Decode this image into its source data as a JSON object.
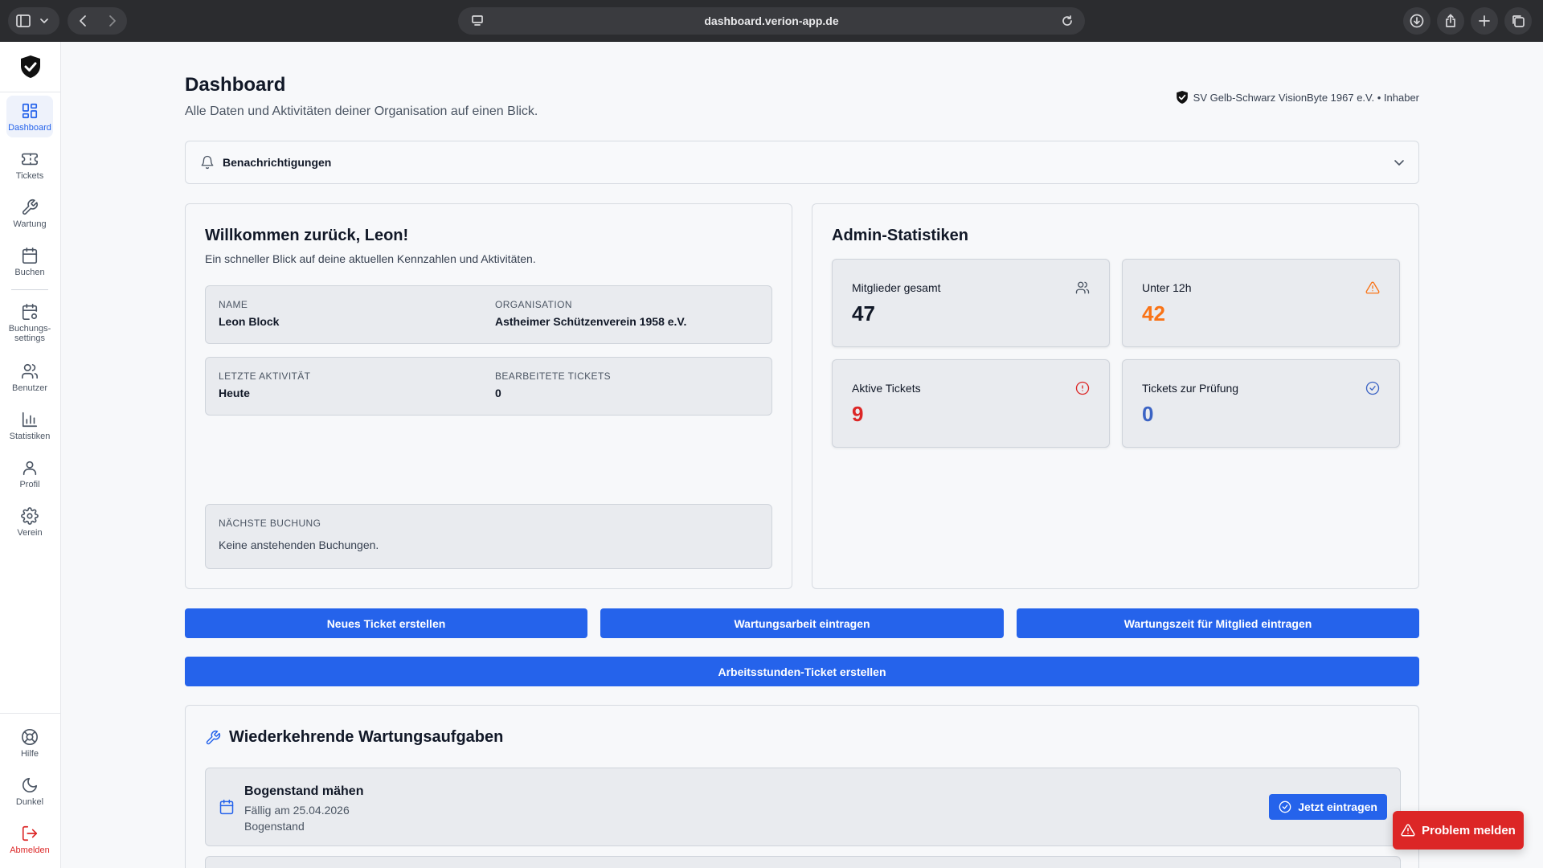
{
  "browser": {
    "url": "dashboard.verion-app.de"
  },
  "sidebar": {
    "items": [
      {
        "label": "Dashboard",
        "icon": "grid-icon"
      },
      {
        "label": "Tickets",
        "icon": "ticket-icon"
      },
      {
        "label": "Wartung",
        "icon": "wrench-icon"
      },
      {
        "label": "Buchen",
        "icon": "calendar-icon"
      },
      {
        "label": "Buchungs-\nsettings",
        "icon": "calendar-settings-icon"
      },
      {
        "label": "Benutzer",
        "icon": "users-icon"
      },
      {
        "label": "Statistiken",
        "icon": "bar-chart-icon"
      },
      {
        "label": "Profil",
        "icon": "user-icon"
      },
      {
        "label": "Verein",
        "icon": "gear-icon"
      }
    ],
    "bottom": [
      {
        "label": "Hilfe",
        "icon": "lifebuoy-icon"
      },
      {
        "label": "Dunkel",
        "icon": "moon-icon"
      },
      {
        "label": "Abmelden",
        "icon": "logout-icon"
      }
    ],
    "active": "Dashboard"
  },
  "header": {
    "title": "Dashboard",
    "subtitle": "Alle Daten und Aktivitäten deiner Organisation auf einen Blick.",
    "org": "SV Gelb-Schwarz VisionByte 1967 e.V. • Inhaber"
  },
  "notifications": {
    "label": "Benachrichtigungen"
  },
  "welcome": {
    "title": "Willkommen zurück, Leon!",
    "description": "Ein schneller Blick auf deine aktuellen Kennzahlen und Aktivitäten.",
    "name_key": "NAME",
    "name_val": "Leon Block",
    "org_key": "ORGANISATION",
    "org_val": "Astheimer Schützenverein 1958 e.V.",
    "activity_key": "LETZTE AKTIVITÄT",
    "activity_val": "Heute",
    "tickets_key": "BEARBEITETE TICKETS",
    "tickets_val": "0",
    "booking_key": "NÄCHSTE BUCHUNG",
    "booking_val": "Keine anstehenden Buchungen."
  },
  "stats": {
    "title": "Admin-Statistiken",
    "members": {
      "label": "Mitglieder gesamt",
      "value": "47",
      "color": "#111827"
    },
    "under12": {
      "label": "Unter 12h",
      "value": "42",
      "color": "#f97316"
    },
    "active": {
      "label": "Aktive Tickets",
      "value": "9",
      "color": "#dc2626"
    },
    "review": {
      "label": "Tickets zur Prüfung",
      "value": "0",
      "color": "#3b63c4"
    }
  },
  "actions": {
    "new_ticket": "Neues Ticket erstellen",
    "maintenance_work": "Wartungsarbeit eintragen",
    "maintenance_member": "Wartungszeit für Mitglied eintragen",
    "hours_ticket": "Arbeitsstunden-Ticket erstellen"
  },
  "recurring": {
    "title": "Wiederkehrende Wartungsaufgaben",
    "tasks": [
      {
        "name": "Bogenstand mähen",
        "due": "Fällig am 25.04.2026",
        "location": "Bogenstand",
        "action": "Jetzt eintragen"
      }
    ]
  },
  "report": {
    "label": "Problem melden"
  },
  "colors": {
    "accent": "#2563eb",
    "danger": "#dc2626"
  }
}
